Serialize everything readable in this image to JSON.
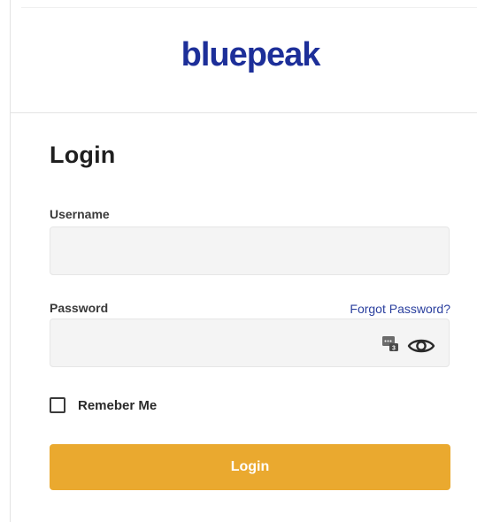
{
  "brand": {
    "logo_text": "bluepeak",
    "logo_color": "#1d2f99"
  },
  "form": {
    "title": "Login",
    "username": {
      "label": "Username",
      "value": "",
      "placeholder": ""
    },
    "password": {
      "label": "Password",
      "value": "",
      "placeholder": "",
      "forgot_link": "Forgot Password?",
      "icons": [
        "password-manager-key-icon",
        "show-password-eye-icon"
      ]
    },
    "remember": {
      "label": "Remeber Me",
      "checked": false
    },
    "submit_label": "Login",
    "accent_color": "#eaa92f",
    "link_color": "#2a3f9e"
  }
}
